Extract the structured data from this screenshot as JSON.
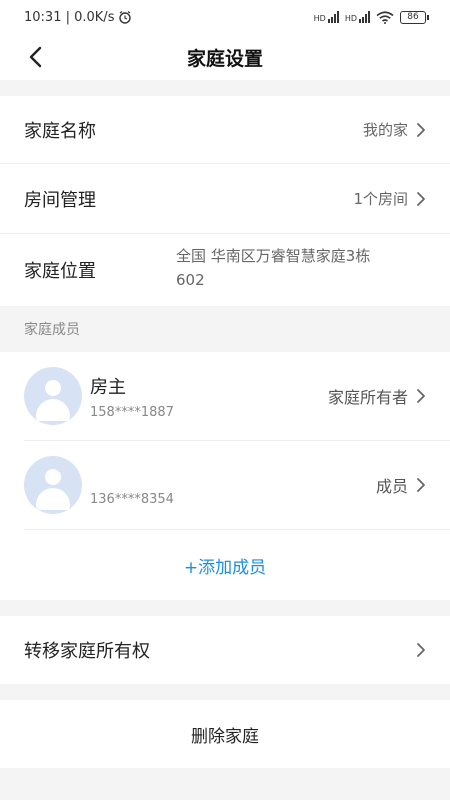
{
  "status_bar": {
    "time_speed": "10:31 | 0.0K/s",
    "alarm_icon": "alarm-clock-icon",
    "signal_icon": "signal-icon",
    "signal_label": "HD",
    "wifi_icon": "wifi-icon",
    "battery_level": "86"
  },
  "header": {
    "back_icon": "chevron-left-icon",
    "title": "家庭设置"
  },
  "settings": {
    "family_name_label": "家庭名称",
    "family_name_value": "我的家",
    "room_management_label": "房间管理",
    "room_management_value": "1个房间",
    "location_label": "家庭位置",
    "location_value_line1": "全国 华南区万睿智慧家庭3栋",
    "location_value_line2": "602"
  },
  "members_section": {
    "title": "家庭成员",
    "members": [
      {
        "name": "房主",
        "phone": "158****1887",
        "role": "家庭所有者"
      },
      {
        "name": "",
        "phone": "136****8354",
        "role": "成员"
      }
    ],
    "add_member_label": "+添加成员"
  },
  "transfer": {
    "label": "转移家庭所有权"
  },
  "delete": {
    "label": "删除家庭"
  },
  "colors": {
    "accent": "#1e8fe0",
    "background": "#f4f4f4",
    "avatar_bg": "#d7e3f4"
  }
}
